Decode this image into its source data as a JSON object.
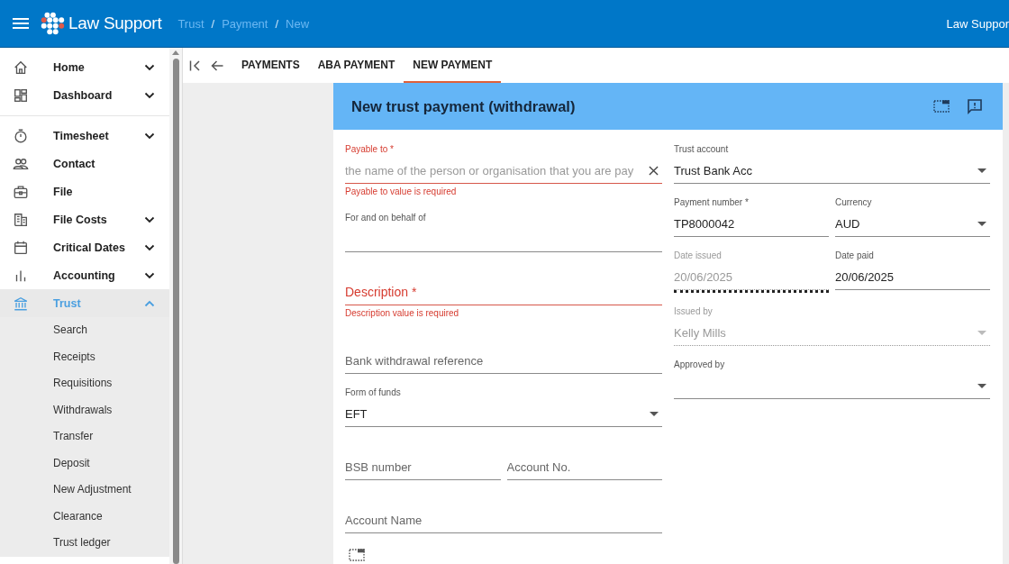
{
  "header": {
    "logo_text": "Law Support",
    "breadcrumb": [
      {
        "kind": "link",
        "text": "Trust"
      },
      {
        "kind": "separator",
        "text": "/"
      },
      {
        "kind": "link",
        "text": "Payment"
      },
      {
        "kind": "separator",
        "text": "/"
      },
      {
        "kind": "link",
        "text": "New"
      }
    ],
    "user": "Law Suppor"
  },
  "sidebar": {
    "sections": [
      {
        "items": [
          {
            "label": "Home",
            "expandable": true,
            "expanded": false,
            "selected": false
          },
          {
            "label": "Dashboard",
            "expandable": true,
            "expanded": false,
            "selected": false
          }
        ]
      },
      {
        "items": [
          {
            "label": "Timesheet",
            "expandable": true,
            "expanded": false,
            "selected": false
          },
          {
            "label": "Contact",
            "expandable": false,
            "expanded": false,
            "selected": false
          },
          {
            "label": "File",
            "expandable": false,
            "expanded": false,
            "selected": false
          },
          {
            "label": "File Costs",
            "expandable": true,
            "expanded": false,
            "selected": false
          },
          {
            "label": "Critical Dates",
            "expandable": true,
            "expanded": false,
            "selected": false
          },
          {
            "label": "Accounting",
            "expandable": true,
            "expanded": false,
            "selected": false
          },
          {
            "label": "Trust",
            "expandable": true,
            "expanded": true,
            "selected": true,
            "children": [
              {
                "label": "Search"
              },
              {
                "label": "Receipts"
              },
              {
                "label": "Requisitions"
              },
              {
                "label": "Withdrawals"
              },
              {
                "label": "Transfer"
              },
              {
                "label": "Deposit"
              },
              {
                "label": "New Adjustment"
              },
              {
                "label": "Clearance"
              },
              {
                "label": "Trust ledger"
              }
            ]
          }
        ]
      }
    ]
  },
  "tabs": [
    {
      "label": "PAYMENTS",
      "selected": false
    },
    {
      "label": "ABA PAYMENT",
      "selected": false
    },
    {
      "label": "NEW PAYMENT",
      "selected": true
    }
  ],
  "card": {
    "title": "New trust payment (withdrawal)",
    "left": [
      {
        "fields": [
          {
            "kind": "text",
            "label": "Payable to *",
            "placeholder": "the name of the person or organisation that you are pay",
            "error": "Payable to value is required",
            "invalid": true,
            "disabled": false,
            "clearable": true
          }
        ]
      },
      {
        "fields": [
          {
            "kind": "text",
            "label": "For and on behalf of",
            "invalid": false,
            "disabled": false,
            "clearable": false
          }
        ]
      },
      {
        "fields": [
          {
            "kind": "text",
            "placeholder": "Description *",
            "error": "Description value is required",
            "invalid": true,
            "disabled": false,
            "clearable": false
          }
        ]
      },
      {
        "fields": [
          {
            "kind": "text",
            "placeholder": "Bank withdrawal reference",
            "invalid": false,
            "disabled": false,
            "clearable": false
          }
        ]
      },
      {
        "fields": [
          {
            "kind": "select",
            "label": "Form of funds",
            "value": "EFT",
            "invalid": false,
            "disabled": false,
            "clearable": false
          }
        ]
      },
      {
        "fields": [
          {
            "kind": "text",
            "placeholder": "BSB number",
            "invalid": false,
            "disabled": false,
            "clearable": false
          },
          {
            "kind": "text",
            "placeholder": "Account No.",
            "invalid": false,
            "disabled": false,
            "clearable": false
          }
        ]
      },
      {
        "fields": [
          {
            "kind": "text",
            "placeholder": "Account Name",
            "invalid": false,
            "disabled": false,
            "clearable": false
          }
        ]
      }
    ],
    "right": [
      {
        "fields": [
          {
            "kind": "select",
            "label": "Trust account",
            "value": "Trust Bank Acc",
            "invalid": false,
            "disabled": false,
            "clearable": false
          }
        ]
      },
      {
        "fields": [
          {
            "kind": "text",
            "label": "Payment number *",
            "value": "TP8000042",
            "invalid": false,
            "disabled": false,
            "clearable": false
          },
          {
            "kind": "select",
            "label": "Currency",
            "value": "AUD",
            "invalid": false,
            "disabled": false,
            "clearable": false
          }
        ]
      },
      {
        "fields": [
          {
            "kind": "text",
            "label": "Date issued",
            "value": "20/06/2025",
            "invalid": false,
            "disabled": true,
            "clearable": false
          },
          {
            "kind": "text",
            "label": "Date paid",
            "value": "20/06/2025",
            "invalid": false,
            "disabled": false,
            "clearable": false
          }
        ]
      },
      {
        "fields": [
          {
            "kind": "select",
            "label": "Issued by",
            "value": "Kelly Mills",
            "invalid": false,
            "disabled": true,
            "clearable": false
          }
        ]
      },
      {
        "fields": [
          {
            "kind": "select",
            "label": "Approved by",
            "invalid": false,
            "disabled": false,
            "clearable": false
          }
        ]
      }
    ]
  }
}
